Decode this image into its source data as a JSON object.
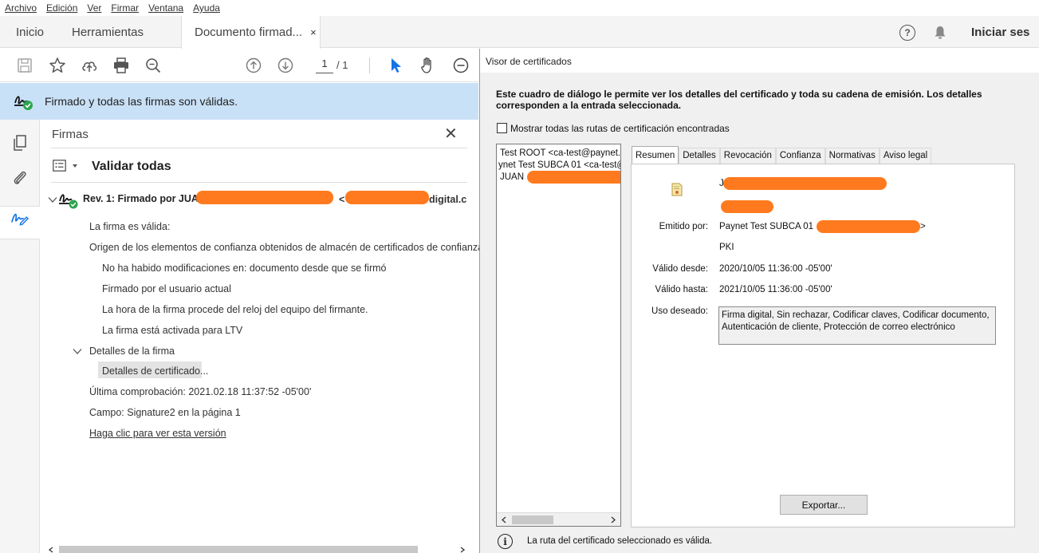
{
  "menu": [
    "Archivo",
    "Edición",
    "Ver",
    "Firmar",
    "Ventana",
    "Ayuda"
  ],
  "tabs": {
    "home": "Inicio",
    "tools": "Herramientas",
    "document": "Documento firmad...",
    "close": "×"
  },
  "header": {
    "sign_in": "Iniciar ses"
  },
  "toolbar": {
    "page_current": "1",
    "page_total": "/ 1"
  },
  "banner": {
    "text": "Firmado y todas las firmas son válidas."
  },
  "signatures": {
    "title": "Firmas",
    "close": "✕",
    "validate_all": "Validar todas",
    "rev_prefix": "Rev. 1: Firmado por JUAN",
    "rev_email_start": "<",
    "rev_email_end": "digital.c",
    "lines": [
      "La firma es válida:",
      "Origen de los elementos de confianza obtenidos de almacén de certificados de confianza de",
      "No ha habido modificaciones en: documento desde que se firmó",
      "Firmado por el usuario actual",
      "La hora de la firma procede del reloj del equipo del firmante.",
      "La firma está activada para LTV",
      "Detalles de la firma",
      "Detalles de certificado...",
      "Última comprobación: 2021.02.18 11:37:52 -05'00'",
      "Campo: Signature2 en la página 1",
      "Haga clic para ver esta versión"
    ]
  },
  "dialog": {
    "title": "Visor de certificados",
    "description": "Este cuadro de diálogo le permite ver los detalles del certificado y toda su cadena de emisión. Los detalles corresponden a la entrada seleccionada.",
    "show_all_paths": "Mostrar todas las rutas de certificación encontradas",
    "chain": [
      "Test ROOT <ca-test@paynet.",
      "ynet Test SUBCA 01 <ca-test@",
      "JUAN"
    ],
    "tabs": [
      "Resumen",
      "Detalles",
      "Revocación",
      "Confianza",
      "Normativas",
      "Aviso legal"
    ],
    "summary": {
      "name_initial": "J",
      "issued_by_label": "Emitido por:",
      "issued_by_value": "Paynet Test SUBCA 01",
      "issued_by_value_end": ">",
      "issued_by_org": "PKI",
      "valid_from_label": "Válido desde:",
      "valid_from_value": "2020/10/05 11:36:00 -05'00'",
      "valid_to_label": "Válido hasta:",
      "valid_to_value": "2021/10/05 11:36:00 -05'00'",
      "usage_label": "Uso deseado:",
      "usage_value": "Firma digital, Sin rechazar, Codificar claves, Codificar documento, Autenticación de cliente, Protección de correo electrónico"
    },
    "export_button": "Exportar...",
    "status": "La ruta del certificado seleccionado es válida."
  },
  "colors": {
    "banner": "#c9e1f7",
    "redaction": "#ff7a1e",
    "valid_green": "#2da44e",
    "accent_blue": "#1473e6"
  }
}
